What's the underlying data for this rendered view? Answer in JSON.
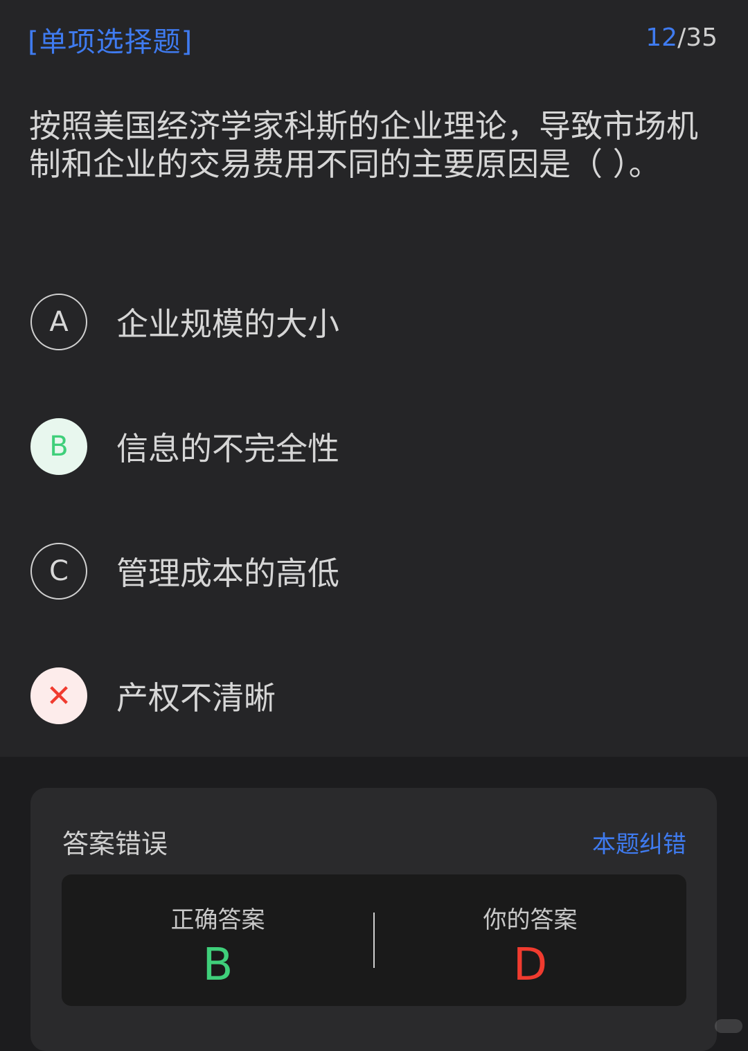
{
  "header": {
    "question_type": "[单项选择题]",
    "current": "12",
    "total": "/35"
  },
  "question": {
    "text": "按照美国经济学家科斯的企业理论，导致市场机制和企业的交易费用不同的主要原因是（ ）。"
  },
  "options": [
    {
      "letter": "A",
      "text": "企业规模的大小",
      "state": "normal"
    },
    {
      "letter": "B",
      "text": "信息的不完全性",
      "state": "correct"
    },
    {
      "letter": "C",
      "text": "管理成本的高低",
      "state": "normal"
    },
    {
      "letter": "✕",
      "text": "产权不清晰",
      "state": "wrong"
    }
  ],
  "result_panel": {
    "title": "答案错误",
    "feedback_link": "本题纠错",
    "correct_label": "正确答案",
    "correct_value": "B",
    "your_label": "你的答案",
    "your_value": "D"
  },
  "colors": {
    "accent": "#3f7bf0",
    "correct": "#3fcf7a",
    "wrong": "#f03b2f"
  }
}
